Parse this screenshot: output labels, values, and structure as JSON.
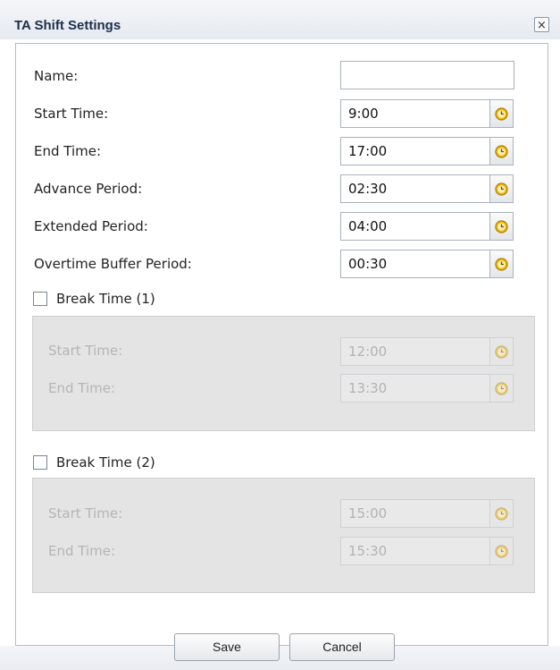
{
  "window": {
    "title": "TA Shift Settings",
    "close_glyph": "×"
  },
  "form": {
    "name": {
      "label": "Name:",
      "value": ""
    },
    "start_time": {
      "label": "Start Time:",
      "value": "9:00"
    },
    "end_time": {
      "label": "End Time:",
      "value": "17:00"
    },
    "advance_period": {
      "label": "Advance Period:",
      "value": "02:30"
    },
    "extended_period": {
      "label": "Extended Period:",
      "value": "04:00"
    },
    "overtime_buffer_period": {
      "label": "Overtime Buffer Period:",
      "value": "00:30"
    }
  },
  "break1": {
    "label": "Break Time (1)",
    "checked": false,
    "start_label": "Start Time:",
    "start_value": "12:00",
    "end_label": "End Time:",
    "end_value": "13:30"
  },
  "break2": {
    "label": "Break Time (2)",
    "checked": false,
    "start_label": "Start Time:",
    "start_value": "15:00",
    "end_label": "End Time:",
    "end_value": "15:30"
  },
  "buttons": {
    "save": "Save",
    "cancel": "Cancel"
  },
  "icons": {
    "clock": "clock-icon",
    "close": "close-icon"
  },
  "colors": {
    "clock_fill": "#f2b705",
    "clock_ring": "#a97a00",
    "title_text": "#1d2e4a"
  }
}
